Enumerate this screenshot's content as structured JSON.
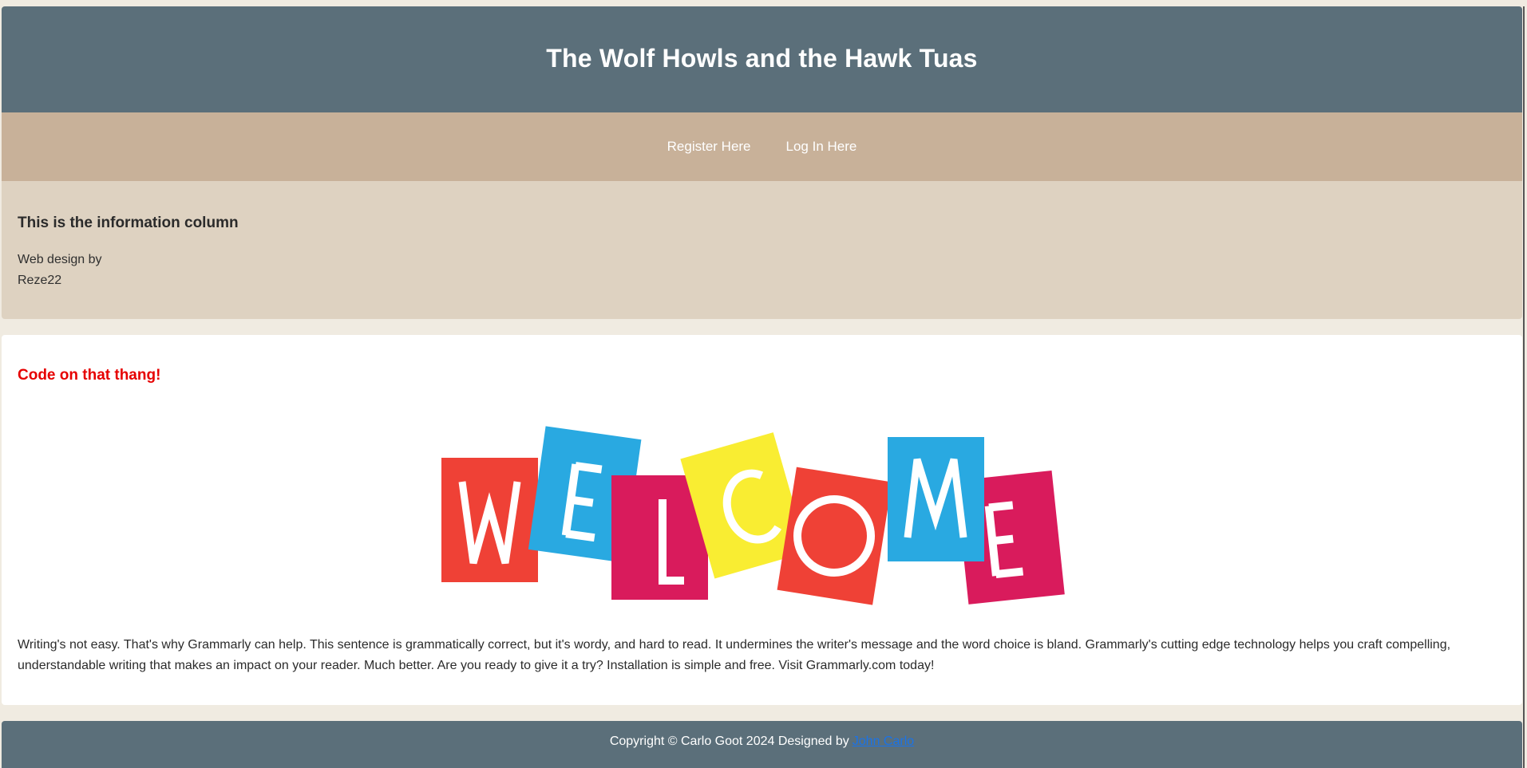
{
  "header": {
    "title": "The Wolf Howls and the Hawk Tuas"
  },
  "nav": {
    "items": [
      {
        "label": "Register Here"
      },
      {
        "label": "Log In Here"
      }
    ]
  },
  "info_column": {
    "heading": "This is the information column",
    "credit_line1": "Web design by",
    "credit_line2": "Reze22"
  },
  "main": {
    "heading": "Code on that thang!",
    "welcome_image": {
      "letters": [
        "W",
        "E",
        "L",
        "C",
        "O",
        "M",
        "E"
      ],
      "colors": [
        "#ef4136",
        "#29a9e1",
        "#d91b5c",
        "#f9ed32",
        "#ef4136",
        "#29a9e1",
        "#d91b5c"
      ]
    },
    "body_text": "Writing's not easy. That's why Grammarly can help. This sentence is grammatically correct, but it's wordy, and hard to read. It undermines the writer's message and the word choice is bland. Grammarly's cutting edge technology helps you craft compelling, understandable writing that makes an impact on your reader. Much better. Are you ready to give it a try? Installation is simple and free. Visit Grammarly.com today!"
  },
  "footer": {
    "text": "Copyright © Carlo Goot 2024 Designed by",
    "link_label": "John Carlo"
  },
  "colors": {
    "header_bg": "#5b6f7a",
    "nav_bg": "#c8b199",
    "info_bg": "#ded2c1",
    "page_bg": "#f0ebe1",
    "heading_red": "#e60000",
    "link_blue": "#1a73e8"
  }
}
